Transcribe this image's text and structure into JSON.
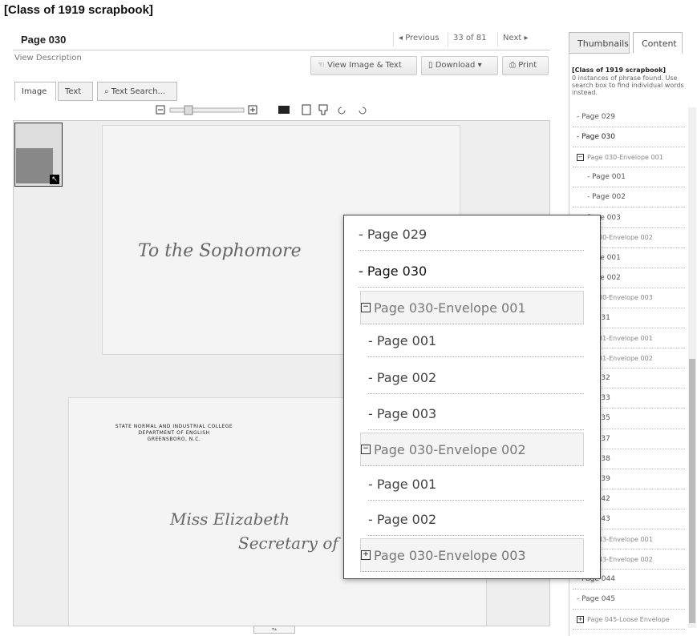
{
  "app": {
    "title": "[Class of 1919 scrapbook]"
  },
  "viewer": {
    "page_label": "Page 030",
    "pager": {
      "previous": "◂ Previous",
      "count": "33 of 81",
      "next": "Next ▸"
    },
    "view_description": "View Description",
    "toolbar": {
      "view_image_text": "View Image & Text",
      "download": "Download",
      "print": "Print"
    },
    "tabs": [
      {
        "label": "Image"
      },
      {
        "label": "Text"
      }
    ],
    "text_search": {
      "placeholder": "Text Search..."
    },
    "scan": {
      "top_envelope_text": "To the Sophomore",
      "letterhead_1": "STATE NORMAL AND INDUSTRIAL COLLEGE",
      "letterhead_2": "DEPARTMENT OF ENGLISH",
      "letterhead_3": "GREENSBORO, N.C.",
      "addressee_1": "Miss Elizabeth",
      "addressee_2": "Secretary of"
    }
  },
  "panel": {
    "tabs": [
      {
        "label": "Thumbnails"
      },
      {
        "label": "Content"
      }
    ],
    "title": "[Class of 1919 scrapbook]",
    "message": "0 instances of phrase found. Use search box to find individual words instead.",
    "items": [
      {
        "label": "- Page 029",
        "level": 1
      },
      {
        "label": "- Page 030",
        "level": 1,
        "bold": true
      },
      {
        "label": "Page 030-Envelope 001",
        "level": 0,
        "expandable": true
      },
      {
        "label": "- Page 001",
        "level": 2
      },
      {
        "label": "- Page 002",
        "level": 2
      },
      {
        "label": "Page 003",
        "level": 2
      },
      {
        "label": "Page 030-Envelope 002",
        "level": 0
      },
      {
        "label": "Page 001",
        "level": 2
      },
      {
        "label": "Page 002",
        "level": 2
      },
      {
        "label": "Page 030-Envelope 003",
        "level": 0
      },
      {
        "label": "Page 031",
        "level": 1
      },
      {
        "label": "Page 031-Envelope 001",
        "level": 0
      },
      {
        "label": "Page 031-Envelope 002",
        "level": 0
      },
      {
        "label": "Page 032",
        "level": 1
      },
      {
        "label": "Page 033",
        "level": 1
      },
      {
        "label": "Page 035",
        "level": 1
      },
      {
        "label": "Page 037",
        "level": 1
      },
      {
        "label": "Page 038",
        "level": 1
      },
      {
        "label": "Page 039",
        "level": 1
      },
      {
        "label": "Page 042",
        "level": 1
      },
      {
        "label": "Page 043",
        "level": 1
      },
      {
        "label": "Page 043-Envelope 001",
        "level": 0
      },
      {
        "label": "Page 043-Envelope 002",
        "level": 0
      },
      {
        "label": "- Page 044",
        "level": 1
      },
      {
        "label": "- Page 045",
        "level": 1
      },
      {
        "label": "Page 045-Loose Envelope",
        "level": 0,
        "expandable": true
      }
    ]
  },
  "popup": {
    "items": [
      {
        "label": "- Page 029",
        "kind": "page"
      },
      {
        "label": "- Page 030",
        "kind": "page",
        "bold": true
      },
      {
        "label": "Page 030-Envelope 001",
        "kind": "env",
        "sign": "−"
      },
      {
        "label": "- Page 001",
        "kind": "sub"
      },
      {
        "label": "- Page 002",
        "kind": "sub"
      },
      {
        "label": "- Page 003",
        "kind": "sub"
      },
      {
        "label": "Page 030-Envelope 002",
        "kind": "env",
        "sign": "−"
      },
      {
        "label": "- Page 001",
        "kind": "sub"
      },
      {
        "label": "- Page 002",
        "kind": "sub"
      },
      {
        "label": "Page 030-Envelope 003",
        "kind": "env",
        "sign": "+"
      }
    ]
  }
}
